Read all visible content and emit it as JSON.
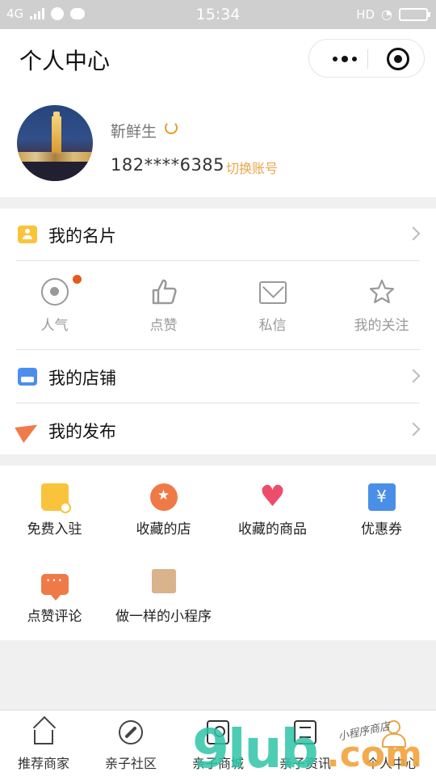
{
  "status_bar": {
    "network": "4G",
    "time": "15:34",
    "hd": "HD"
  },
  "nav": {
    "title": "个人中心"
  },
  "profile": {
    "name": "靳鲜生",
    "phone": "182****6385",
    "switch_label": "切换账号"
  },
  "menu": {
    "card": "我的名片",
    "shop": "我的店铺",
    "publish": "我的发布"
  },
  "social": [
    {
      "label": "人气",
      "icon": "eye-icon"
    },
    {
      "label": "点赞",
      "icon": "thumbs-up-icon"
    },
    {
      "label": "私信",
      "icon": "mail-icon"
    },
    {
      "label": "我的关注",
      "icon": "star-icon"
    }
  ],
  "grid": [
    {
      "label": "免费入驻",
      "icon": "store-plus-icon"
    },
    {
      "label": "收藏的店",
      "icon": "favorite-shop-icon"
    },
    {
      "label": "收藏的商品",
      "icon": "heart-icon"
    },
    {
      "label": "优惠券",
      "icon": "coupon-icon"
    },
    {
      "label": "点赞评论",
      "icon": "comment-icon"
    },
    {
      "label": "做一样的小程序",
      "icon": "diamond-icon"
    }
  ],
  "tabbar": [
    {
      "label": "推荐商家",
      "icon": "home-icon"
    },
    {
      "label": "亲子社区",
      "icon": "compass-icon"
    },
    {
      "label": "亲子商城",
      "icon": "mall-icon"
    },
    {
      "label": "亲子资讯",
      "icon": "news-icon"
    },
    {
      "label": "个人中心",
      "icon": "user-icon",
      "active": true
    }
  ],
  "watermark": {
    "main": "9lub",
    "suffix": ".com",
    "script": "小程序商店"
  },
  "colors": {
    "accent_orange": "#e8a54c",
    "badge_red": "#e55a1e",
    "heart": "#ee4c6c",
    "blue": "#4a8fe7",
    "yellow": "#f8c43a"
  }
}
